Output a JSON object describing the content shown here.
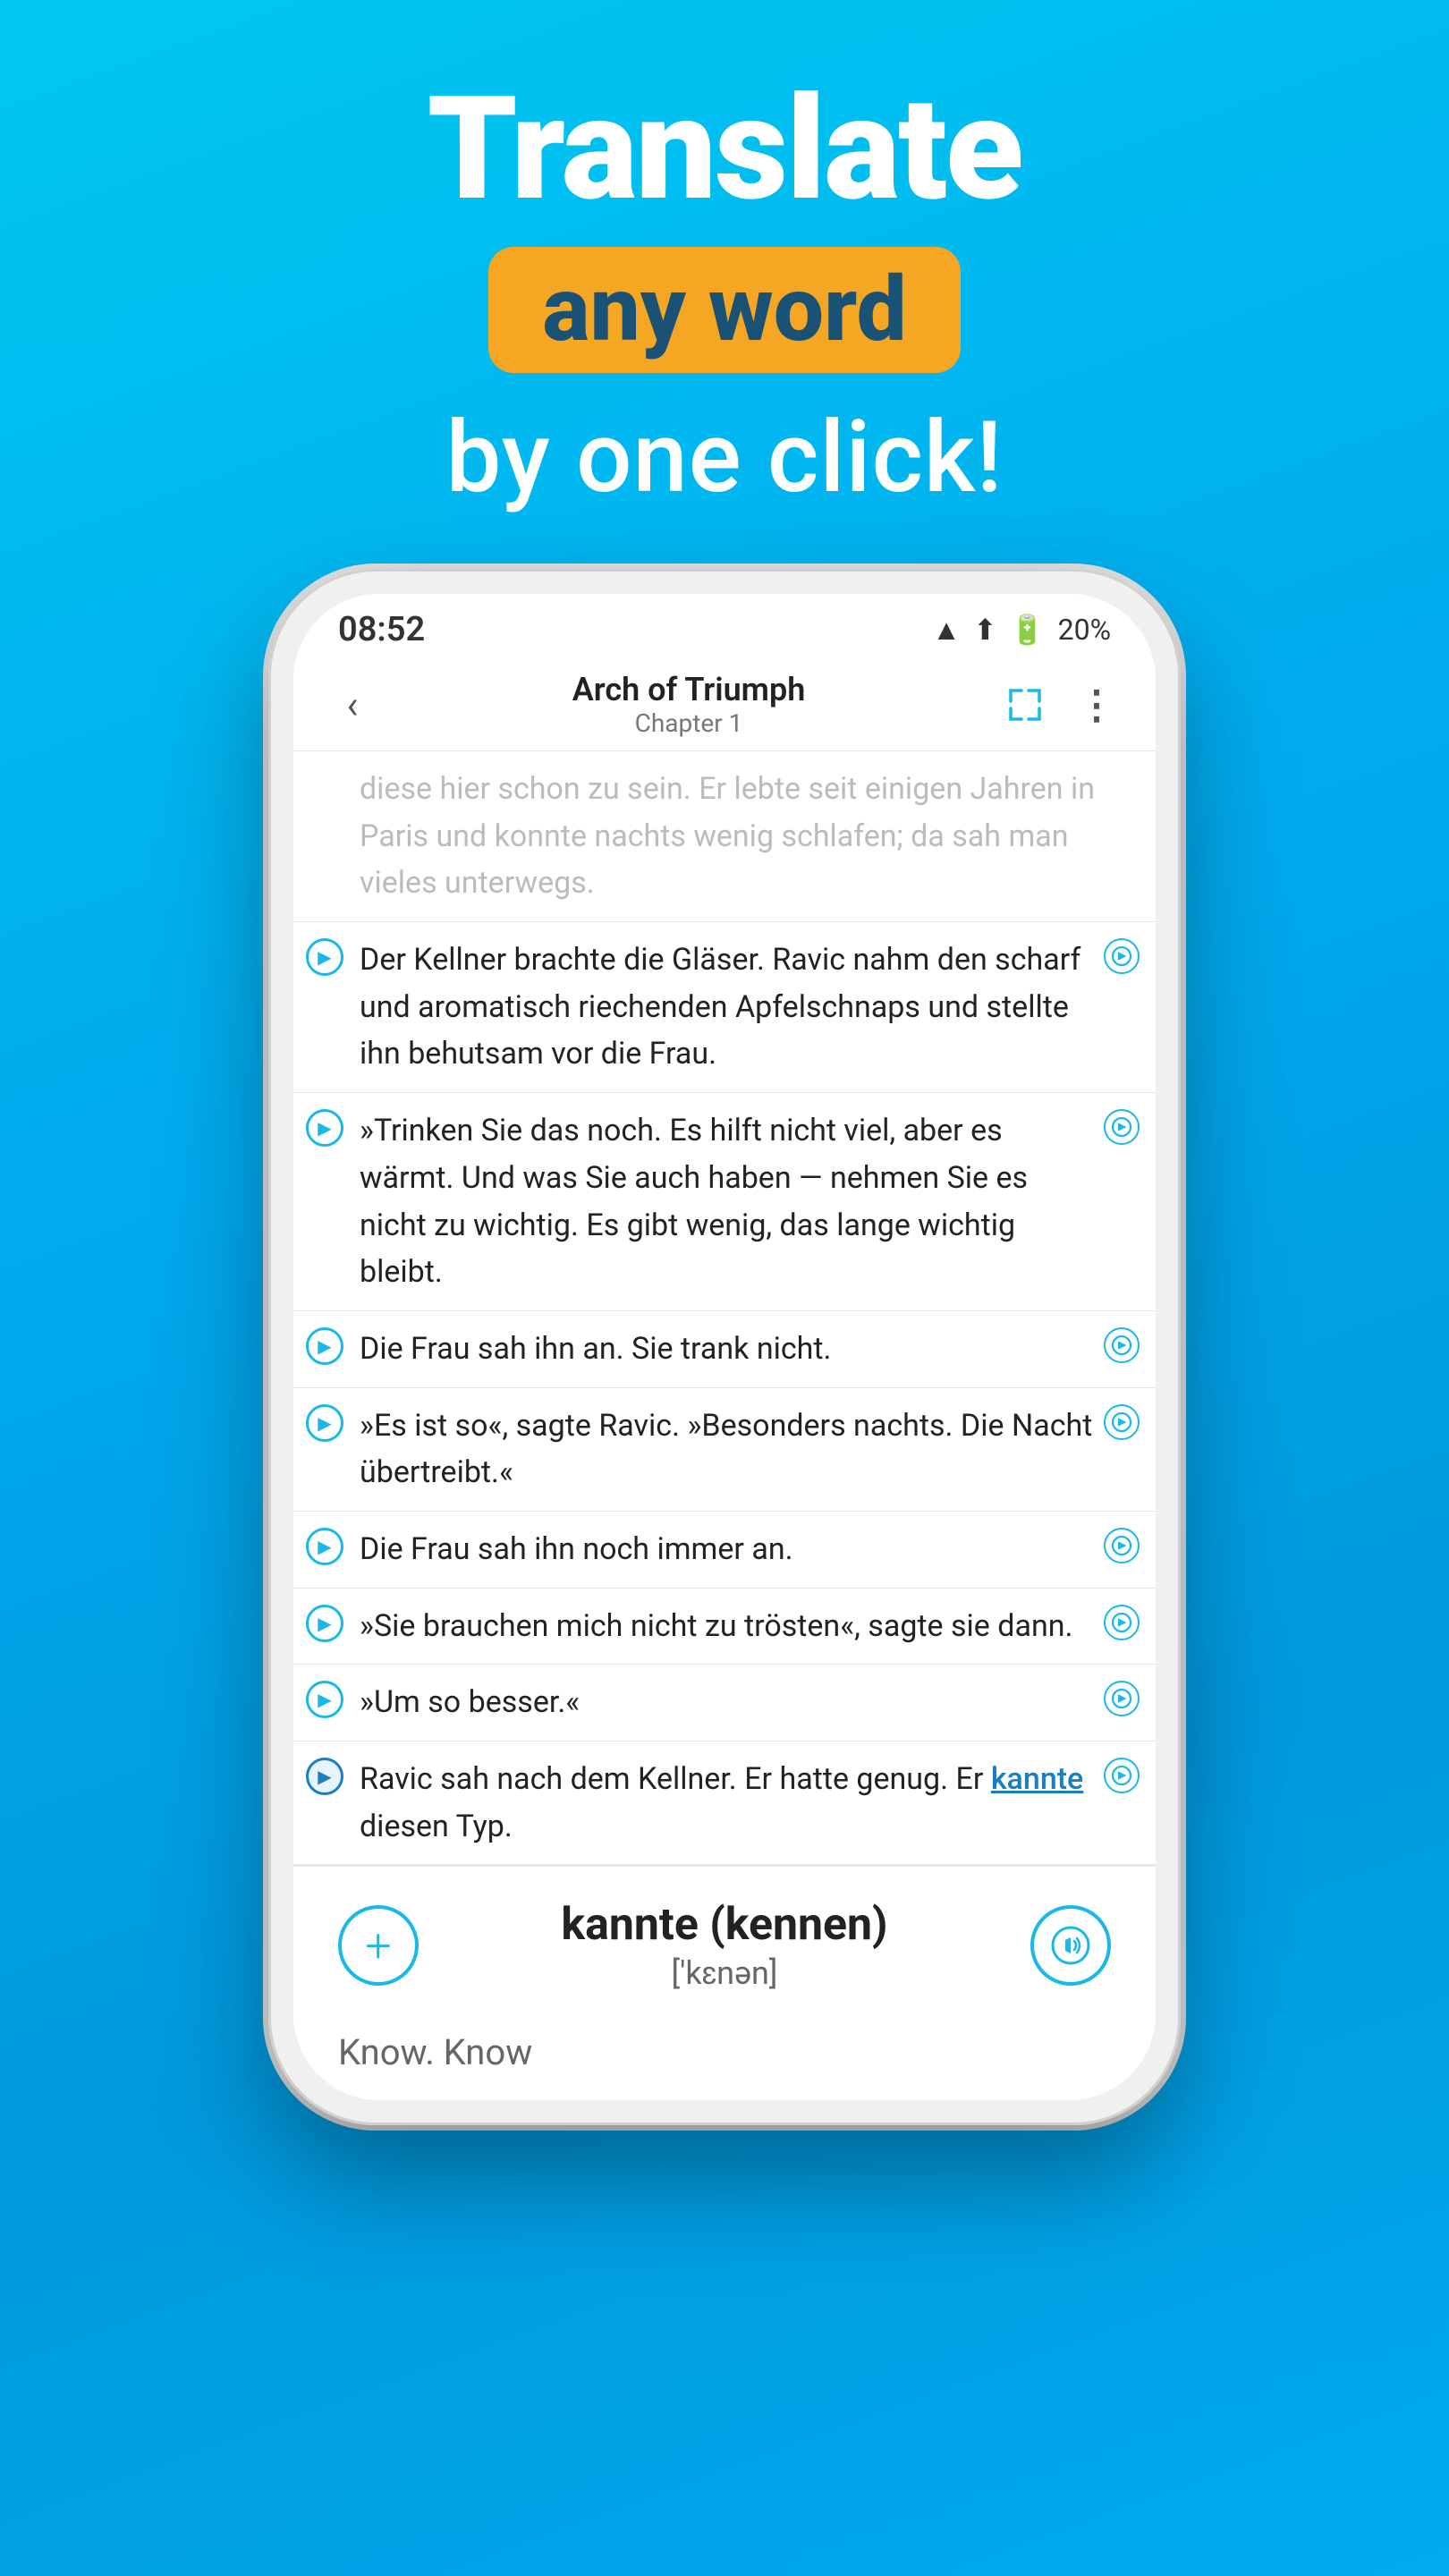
{
  "background": {
    "color": "#00b8e8"
  },
  "headline": {
    "title": "Translate",
    "badge": "any word",
    "subtitle": "by one click!"
  },
  "phone": {
    "status_bar": {
      "time": "08:52",
      "battery": "20%",
      "signal_icon": "▲▲",
      "wifi_icon": "R"
    },
    "book_header": {
      "back_label": "‹",
      "title": "Arch of Triumph",
      "chapter": "Chapter 1",
      "expand_icon": "⤢",
      "more_icon": "⋮"
    },
    "paragraphs": [
      {
        "id": "p1",
        "text_start": "diese hier schon zu sein. Er lebte seit einigen Jahren in Paris und konnte nachts wenig schlafen; da sah man vieles unterwegs.",
        "has_play": false,
        "has_end": false
      },
      {
        "id": "p2",
        "text": "Der Kellner brachte die Gläser. Ravic nahm den scharf und aromatisch riechenden Apfelschnaps und stellte ihn behutsam vor die Frau.",
        "has_play": true,
        "has_end": true
      },
      {
        "id": "p3",
        "text": "»Trinken Sie das noch. Es hilft nicht viel, aber es wärmt. Und was Sie auch haben — nehmen Sie es nicht zu wichtig. Es gibt wenig, das lange wichtig bleibt.",
        "has_play": true,
        "has_end": true
      },
      {
        "id": "p4",
        "text": "Die Frau sah ihn an. Sie trank nicht.",
        "has_play": true,
        "has_end": true
      },
      {
        "id": "p5",
        "text": "»Es ist so«, sagte Ravic. »Besonders nachts. Die Nacht übertreibt.«",
        "has_play": true,
        "has_end": true
      },
      {
        "id": "p6",
        "text": "Die Frau sah ihn noch immer an.",
        "has_play": true,
        "has_end": true
      },
      {
        "id": "p7",
        "text": "»Sie brauchen mich nicht zu trösten«, sagte sie dann.",
        "has_play": true,
        "has_end": true
      },
      {
        "id": "p8",
        "text": "»Um so besser.«",
        "has_play": true,
        "has_end": true
      },
      {
        "id": "p9",
        "text_before_highlight": "Ravic sah nach dem Kellner. Er hatte genug. Er ",
        "word_highlighted": "kannte",
        "text_after_highlight": " diesen Typ.",
        "has_play": true,
        "has_end": true
      }
    ],
    "translation_panel": {
      "word": "kannte (kennen)",
      "phonetic": "['kɛnən]",
      "add_label": "+",
      "sound_label": "🔊",
      "meaning": "Know. Know"
    }
  }
}
